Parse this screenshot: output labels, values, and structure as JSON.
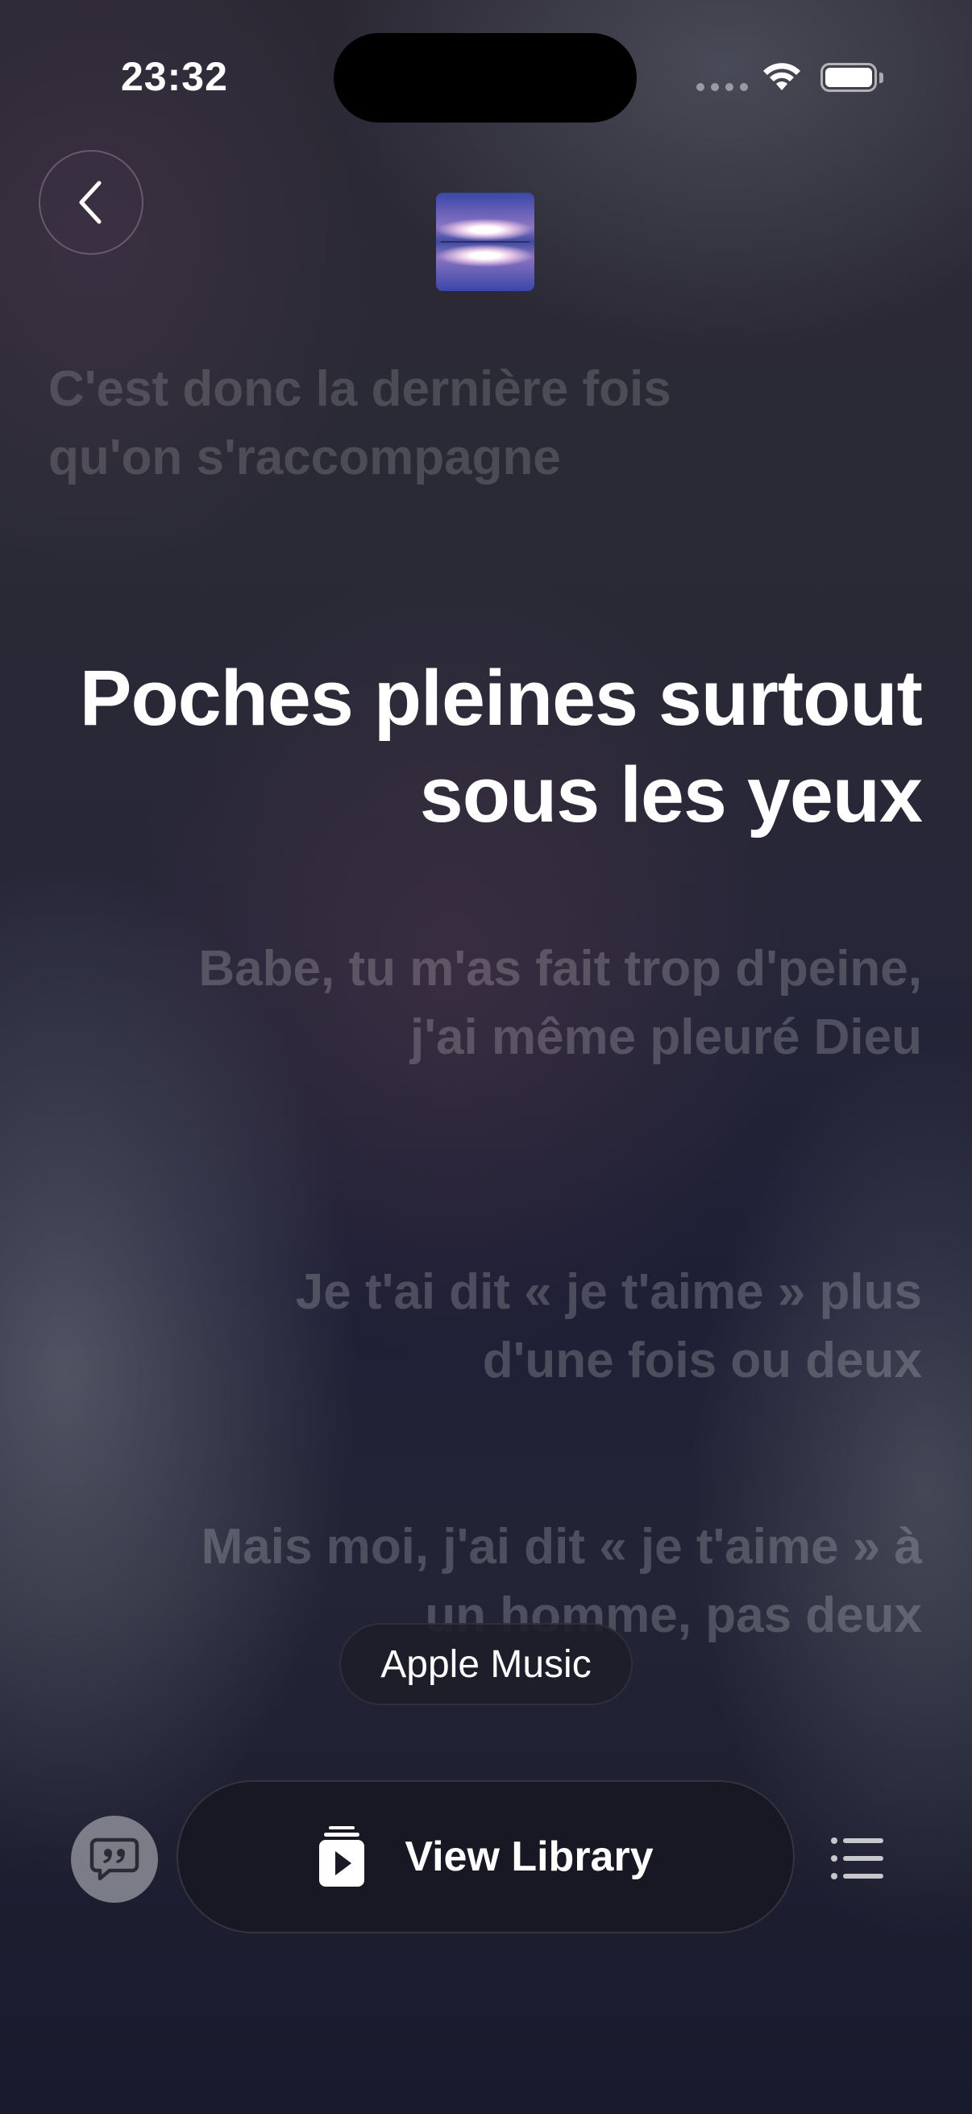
{
  "status_bar": {
    "time": "23:32"
  },
  "header": {
    "back_icon": "chevron-left-icon",
    "album_art": "album-artwork"
  },
  "lyrics": {
    "past": "C'est donc la dernière fois qu'on s'raccompagne",
    "current": "Poches pleines surtout sous les yeux",
    "next": [
      "Babe, tu m'as fait trop d'peine, j'ai même pleuré Dieu",
      "Je t'ai dit « je t'aime » plus d'une fois ou deux",
      "Mais moi, j'ai dit « je t'aime » à un homme, pas deux"
    ]
  },
  "source_badge": {
    "label": "Apple Music"
  },
  "bottom_bar": {
    "lyrics_icon": "quote-bubble-icon",
    "library_button_icon": "library-stack-play-icon",
    "library_button_label": "View Library",
    "queue_icon": "list-bullet-icon"
  },
  "colors": {
    "active_lyric": "#ffffff",
    "inactive_lyric": "rgba(255,255,255,0.2)"
  }
}
